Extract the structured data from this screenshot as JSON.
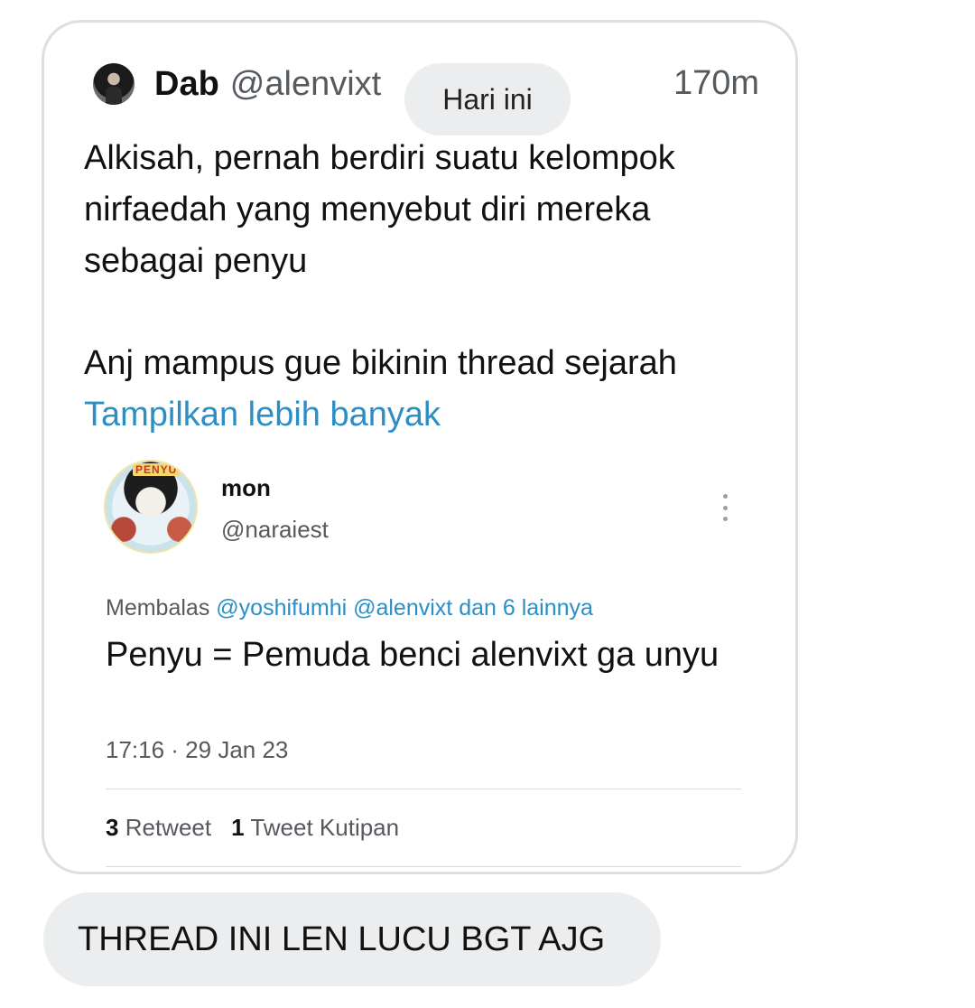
{
  "tweet": {
    "author_name": "Dab",
    "author_handle": "@alenvixt",
    "time": "170m",
    "body_lines": [
      "Alkisah, pernah berdiri suatu kelompok nirfaedah yang menyebut diri mereka sebagai penyu",
      "Anj mampus gue bikinin thread sejarah"
    ],
    "show_more": "Tampilkan lebih banyak"
  },
  "date_pill": "Hari ini",
  "embedded": {
    "avatar_tag": "PENYU",
    "name": "mon",
    "handle": "@naraiest",
    "reply_prefix": "Membalas",
    "reply_mentions": "@yoshifumhi @alenvixt dan 6 lainnya",
    "text": "Penyu = Pemuda benci alenvixt ga unyu",
    "timestamp": "17:16 · 29 Jan 23",
    "retweet_count": "3",
    "retweet_label": "Retweet",
    "quote_count": "1",
    "quote_label": "Tweet Kutipan"
  },
  "message": "THREAD INI LEN LUCU BGT AJG",
  "colors": {
    "link": "#2b8fc6",
    "bubble": "#ebedee",
    "border": "#dcdfe2"
  }
}
